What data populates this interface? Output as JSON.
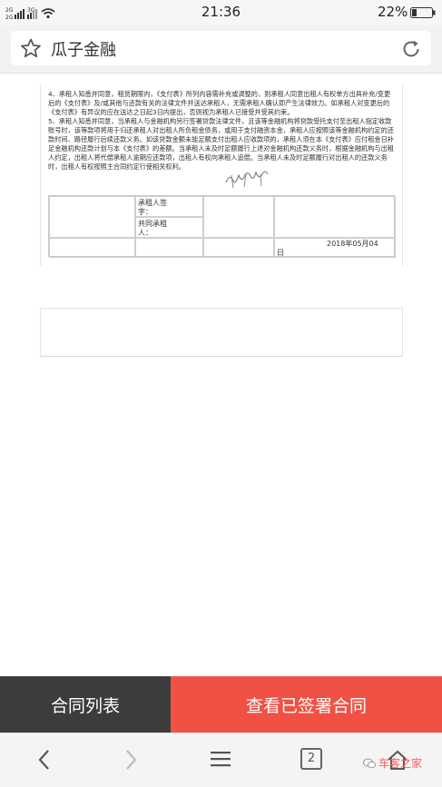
{
  "status_bar": {
    "network_top": "2G",
    "network_bottom": "2G",
    "network_3g": "3G",
    "time": "21:36",
    "battery": "22%"
  },
  "browser": {
    "title": "瓜子金融"
  },
  "document": {
    "clauses": [
      "4、承租人知悉并同意，租赁期限内，《支付表》所列内容需补充或调整的，则承租人同意出租人有权单方出具补充/变更后的《支付表》及/或其他与还款有关的法律文件并送达承租人，无需承租人确认即产生法律效力。如承租人对变更后的《支付表》有异议的应在送达之日起3日内提出，否则视为承租人已接受并受其约束。",
      "5、承租人知悉并同意，当承租人与金融机构另行签署贷款法律文件，且该等金融机构将贷款受托支付至出租人指定收款账号时，该等款项将用于归还承租人对出租人所负租金债务，或用于支付融资本金，承租人应按照该等金融机构约定的还款时间、路径履行后续还款义务。如该贷款金额未能足额支付出租人应收款项的，承租人须在本《支付表》应付租金日补足金融机构还款计划与本《支付表》的差额。当承租人未及时足额履行上述对金融机构还款义务时，根据金融机构与出租人约定，出租人将代偿承租人逾期应还款项，出租人有权向承租人追偿。当承租人未及时足额履行对出租人的还款义务时，出租人有权按照主合同约定行使相关权利。"
    ],
    "signature": {
      "lessee_label_1": "承租人签",
      "lessee_label_2": "字：",
      "co_lessee_label_1": "共同承租",
      "co_lessee_label_2": "人：",
      "date": "2018年05月04",
      "date_suffix": "日"
    }
  },
  "actions": {
    "contract_list": "合同列表",
    "view_signed": "查看已签署合同"
  },
  "nav": {
    "tab_count": "2",
    "watermark": "车客之家"
  },
  "colors": {
    "accent_red": "#ef5245",
    "dark_button": "#3c3c3c"
  }
}
